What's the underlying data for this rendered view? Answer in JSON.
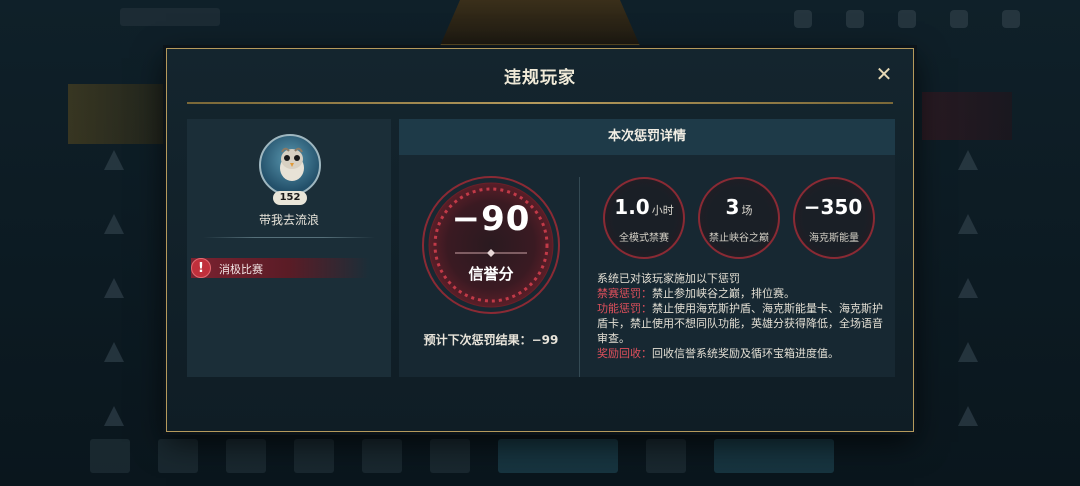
{
  "modal": {
    "title": "违规玩家",
    "close_label": "✕"
  },
  "player": {
    "level": "152",
    "name": "带我去流浪",
    "violation_icon": "!",
    "violation_label": "消极比赛"
  },
  "detail": {
    "header": "本次惩罚详情",
    "credit_change": "−90",
    "credit_label": "信誉分",
    "next_result_label": "预计下次惩罚结果：",
    "next_result_value": "−99",
    "penalties": [
      {
        "value": "1.0",
        "unit": "小时",
        "desc": "全模式禁赛"
      },
      {
        "value": "3",
        "unit": "场",
        "desc": "禁止峡谷之巅"
      },
      {
        "value": "−350",
        "unit": "",
        "desc": "海克斯能量"
      }
    ],
    "notice": {
      "intro": "系统已对该玩家施加以下惩罚",
      "items": [
        {
          "label": "禁赛惩罚：",
          "text": "禁止参加峡谷之巅，排位赛。"
        },
        {
          "label": "功能惩罚：",
          "text": "禁止使用海克斯护盾、海克斯能量卡、海克斯护盾卡，禁止使用不想同队功能，英雄分获得降低，全场语音审查。"
        },
        {
          "label": "奖励回收：",
          "text": "回收信誉系统奖励及循环宝箱进度值。"
        }
      ]
    }
  },
  "colors": {
    "accent_gold": "#b59a5c",
    "penalty_red": "#e0505c",
    "dial_red": "#8a2a34"
  }
}
